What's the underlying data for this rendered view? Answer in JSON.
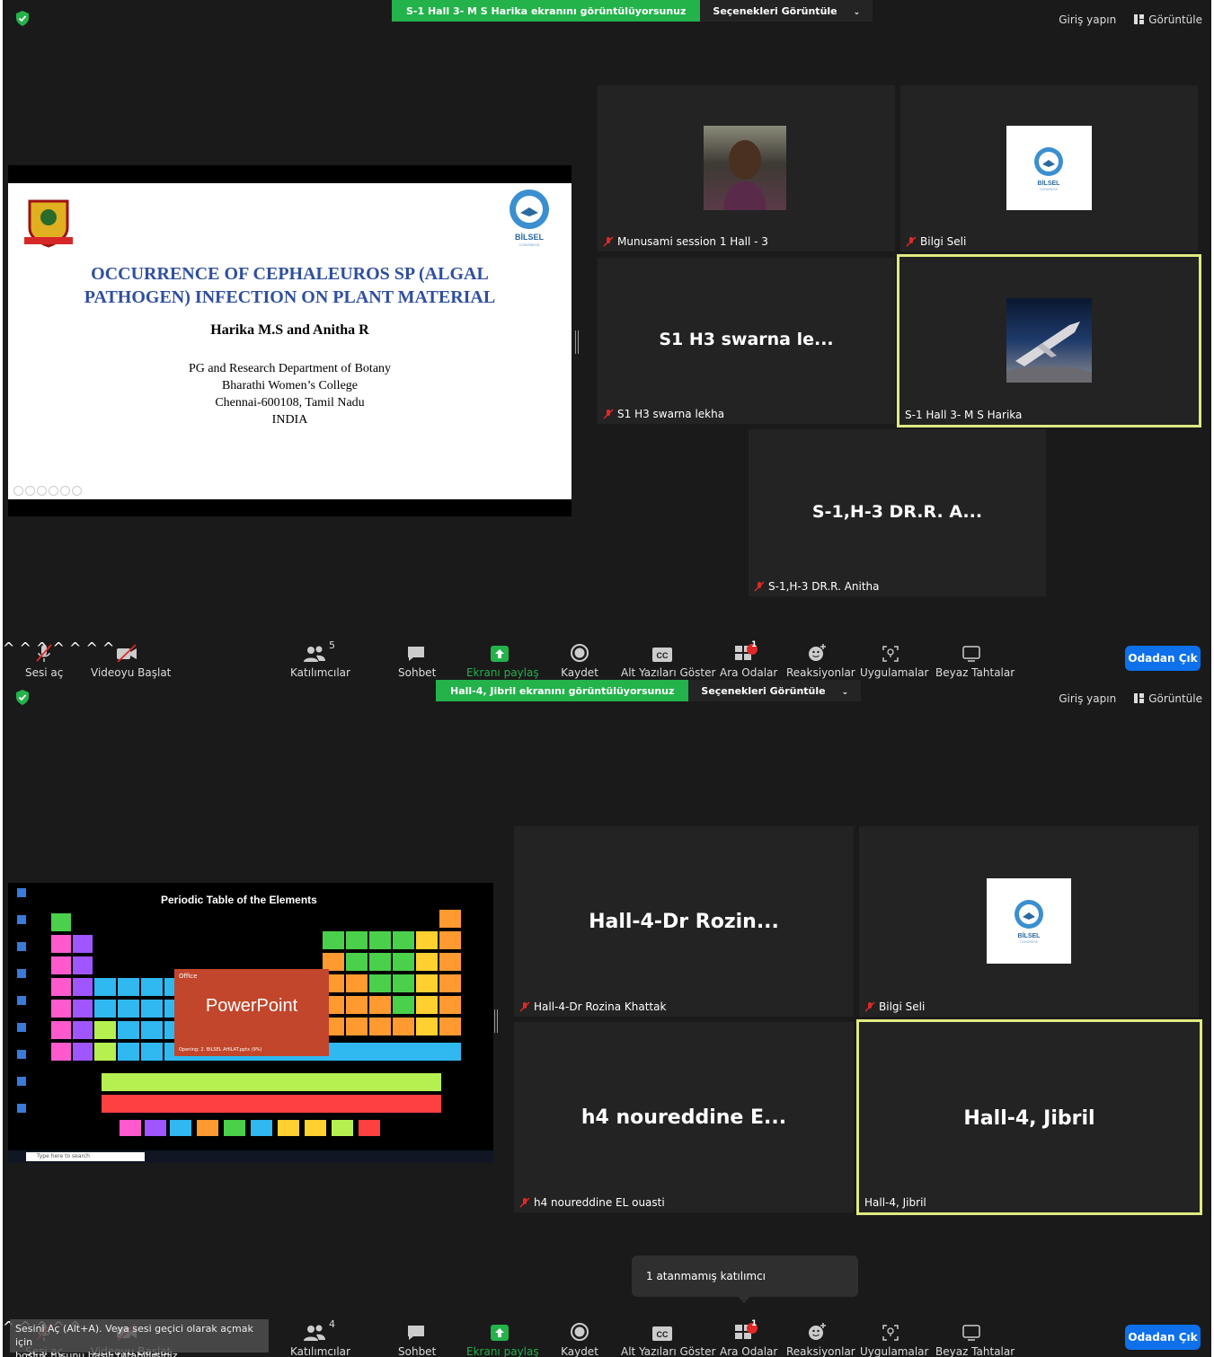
{
  "window1": {
    "share_banner": "S-1 Hall 3- M S Harika ekranını görüntülüyorsunuz",
    "view_options": "Seçenekleri Görüntüle",
    "sign_in": "Giriş yapın",
    "view": "Görüntüle",
    "slide": {
      "title_line1": "OCCURRENCE OF CEPHALEUROS SP (ALGAL",
      "title_line2": "PATHOGEN) INFECTION ON PLANT MATERIAL",
      "authors": "Harika  M.S  and Anitha R",
      "aff_line1": "PG and Research Department of Botany",
      "aff_line2": "Bharathi Women’s College",
      "aff_line3": "Chennai-600108, Tamil Nadu",
      "aff_line4": "INDIA",
      "logo_text": "BİLSEL",
      "logo_sub": "CONGRESS"
    },
    "tiles": [
      {
        "name": "Munusami session 1 Hall - 3",
        "muted": true
      },
      {
        "name": "Bilgi Seli",
        "muted": true
      },
      {
        "name": "S1 H3 swarna lekha",
        "big": "S1 H3 swarna le...",
        "muted": true
      },
      {
        "name": "S-1 Hall 3- M S Harika",
        "muted": false
      },
      {
        "name": "S-1,H-3 DR.R. Anitha",
        "big": "S-1,H-3 DR.R. A...",
        "muted": true
      }
    ],
    "bilsel_logo": {
      "text": "BİLSEL",
      "sub": "CONGRESS"
    },
    "toolbar": {
      "unmute": "Sesi aç",
      "start_video": "Videoyu Başlat",
      "participants": "Katılımcılar",
      "participants_count": "5",
      "chat": "Sohbet",
      "share": "Ekranı paylaş",
      "record": "Kaydet",
      "captions": "Alt Yazıları Göster",
      "breakout": "Ara Odalar",
      "breakout_badge": "1",
      "reactions": "Reaksiyonlar",
      "apps": "Uygulamalar",
      "whiteboards": "Beyaz Tahtalar",
      "leave": "Odadan Çık",
      "cc": "CC"
    }
  },
  "window2": {
    "share_banner": "Hall-4, Jibril ekranını görüntülüyorsunuz",
    "view_options": "Seçenekleri Görüntüle",
    "sign_in": "Giriş yapın",
    "view": "Görüntüle",
    "screen": {
      "pt_title": "Periodic Table of the Elements",
      "ppt_brand": "Office",
      "ppt_name": "PowerPoint",
      "ppt_status": "Opening: 2. BILSEL AHILAT.pptx (9%)",
      "search": "Type here to search"
    },
    "tiles": [
      {
        "name": "Hall-4-Dr Rozina Khattak",
        "big": "Hall-4-Dr  Rozin...",
        "muted": true
      },
      {
        "name": "Bilgi Seli",
        "muted": true
      },
      {
        "name": "h4 noureddine EL ouasti",
        "big": "h4 noureddine E...",
        "muted": true
      },
      {
        "name": "Hall-4, Jibril",
        "big": "Hall-4, Jibril",
        "muted": false
      }
    ],
    "unassigned_tooltip": "1 atanmamış katılımcı",
    "mute_tip_line1": "Sesini Aç (Alt+A). Veya sesi geçici olarak açmak için",
    "mute_tip_line2": "boşluk tuşunu basılı tutabilirsiniz.",
    "toolbar": {
      "unmute": "Sesi aç",
      "start_video": "Videoyu Başlat",
      "participants": "Katılımcılar",
      "participants_count": "4",
      "chat": "Sohbet",
      "share": "Ekranı paylaş",
      "record": "Kaydet",
      "captions": "Alt Yazıları Göster",
      "breakout": "Ara Odalar",
      "breakout_badge": "1",
      "reactions": "Reaksiyonlar",
      "apps": "Uygulamalar",
      "whiteboards": "Beyaz Tahtalar",
      "leave": "Odadan Çık",
      "cc": "CC"
    }
  },
  "colors": {
    "zoom_bg": "#1a1a1a",
    "tile_bg": "#232323",
    "share_green": "#24b24b",
    "active_speaker": "#e0ea81",
    "leave_blue": "#0e71eb",
    "mute_red": "#e02828"
  }
}
